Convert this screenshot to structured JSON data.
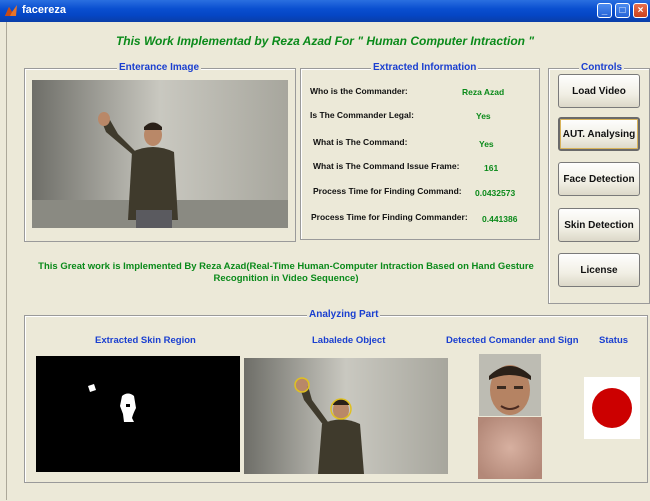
{
  "window": {
    "title": "facereza"
  },
  "heading": "This Work Implementad by Reza Azad For \" Human Computer Intraction \"",
  "entrance": {
    "label": "Enterance Image"
  },
  "info": {
    "label": "Extracted Information",
    "rows": [
      {
        "label": "Who is the Commander:",
        "value": "Reza Azad"
      },
      {
        "label": "Is The Commander Legal:",
        "value": "Yes"
      },
      {
        "label": "What is The Command:",
        "value": "Yes"
      },
      {
        "label": "What is The Command Issue Frame:",
        "value": "161"
      },
      {
        "label": "Process Time for Finding Command:",
        "value": "0.0432573"
      },
      {
        "label": "Process Time for Finding Commander:",
        "value": "0.441386"
      }
    ]
  },
  "controls": {
    "label": "Controls",
    "buttons": [
      "Load Video",
      "AUT. Analysing",
      "Face Detection",
      "Skin Detection",
      "License"
    ]
  },
  "note": "This Great work is Implemented By Reza Azad(Real-Time Human-Computer Intraction Based on Hand Gesture Recognition in Video Sequence)",
  "analyzing": {
    "label": "Analyzing Part",
    "columns": [
      "Extracted Skin Region",
      "Labalede Object",
      "Detected Comander and Sign",
      "Status"
    ]
  },
  "colors": {
    "heading": "#0a8a1a",
    "panel_label": "#1a3fd0",
    "status_dot": "#cc0000"
  }
}
